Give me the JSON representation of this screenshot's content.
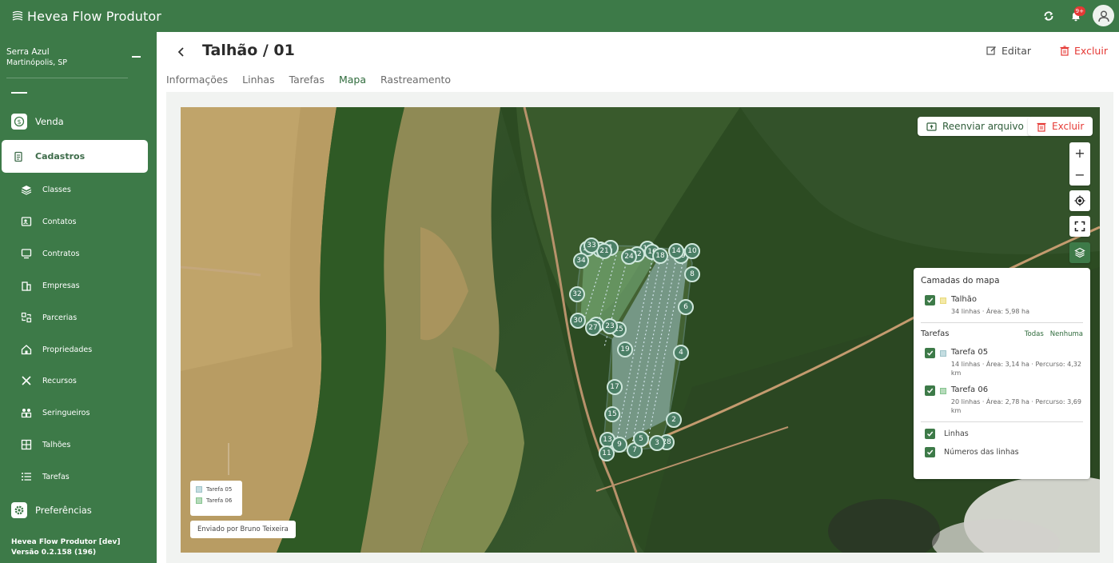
{
  "app": {
    "name": "Hevea Flow Produtor",
    "notification_count": "9+"
  },
  "farm": {
    "name": "Serra Azul",
    "location": "Martinópolis, SP"
  },
  "nav": {
    "venda": "Venda",
    "cadastros": "Cadastros",
    "sub_items": [
      {
        "label": "Classes",
        "icon": "layers-icon"
      },
      {
        "label": "Contatos",
        "icon": "contacts-icon"
      },
      {
        "label": "Contratos",
        "icon": "contract-icon"
      },
      {
        "label": "Empresas",
        "icon": "building-icon"
      },
      {
        "label": "Parcerias",
        "icon": "handshake-icon"
      },
      {
        "label": "Propriedades",
        "icon": "home-icon"
      },
      {
        "label": "Recursos",
        "icon": "tools-icon"
      },
      {
        "label": "Seringueiros",
        "icon": "workers-icon"
      },
      {
        "label": "Talhões",
        "icon": "grid-icon"
      },
      {
        "label": "Tarefas",
        "icon": "list-icon"
      }
    ],
    "preferencias": "Preferências"
  },
  "version": {
    "app_label": "Hevea Flow Produtor [dev]",
    "version_label": "Versão 0.2.158 (196)"
  },
  "page": {
    "title": "Talhão / 01",
    "edit_label": "Editar",
    "delete_label": "Excluir",
    "tabs": [
      "Informações",
      "Linhas",
      "Tarefas",
      "Mapa",
      "Rastreamento"
    ],
    "active_tab": "Mapa"
  },
  "map": {
    "resend_label": "Reenviar arquivo",
    "delete_label": "Excluir",
    "zoom_in": "+",
    "zoom_out": "−",
    "legend": [
      "Tarefa 05",
      "Tarefa 06"
    ],
    "uploaded_by": "Enviado por Bruno Teixeira",
    "line_numbers": [
      "33",
      "34",
      "32",
      "30",
      "27",
      "23",
      "19",
      "17",
      "15",
      "13",
      "11",
      "9",
      "7",
      "5",
      "3",
      "2",
      "4",
      "6",
      "8",
      "10",
      "14",
      "24",
      "1",
      "12",
      "16",
      "18",
      "20",
      "21",
      "22",
      "25",
      "26",
      "28",
      "29",
      "31"
    ]
  },
  "layers": {
    "title": "Camadas do mapa",
    "talhao": {
      "name": "Talhão",
      "details": "34 linhas · Área: 5,98 ha",
      "color": "#e8d97a"
    },
    "tasks_label": "Tarefas",
    "all_label": "Todas",
    "none_label": "Nenhuma",
    "tasks": [
      {
        "name": "Tarefa 05",
        "details": "14 linhas · Área: 3,14 ha · Percurso: 4,32 km",
        "color": "#9ec3c8"
      },
      {
        "name": "Tarefa 06",
        "details": "20 linhas · Área: 2,78 ha · Percurso: 3,69 km",
        "color": "#86c48f"
      }
    ],
    "linhas_label": "Linhas",
    "numbers_label": "Números das linhas"
  },
  "colors": {
    "brand_green": "#3d7a48",
    "danger_red": "#e53935"
  }
}
